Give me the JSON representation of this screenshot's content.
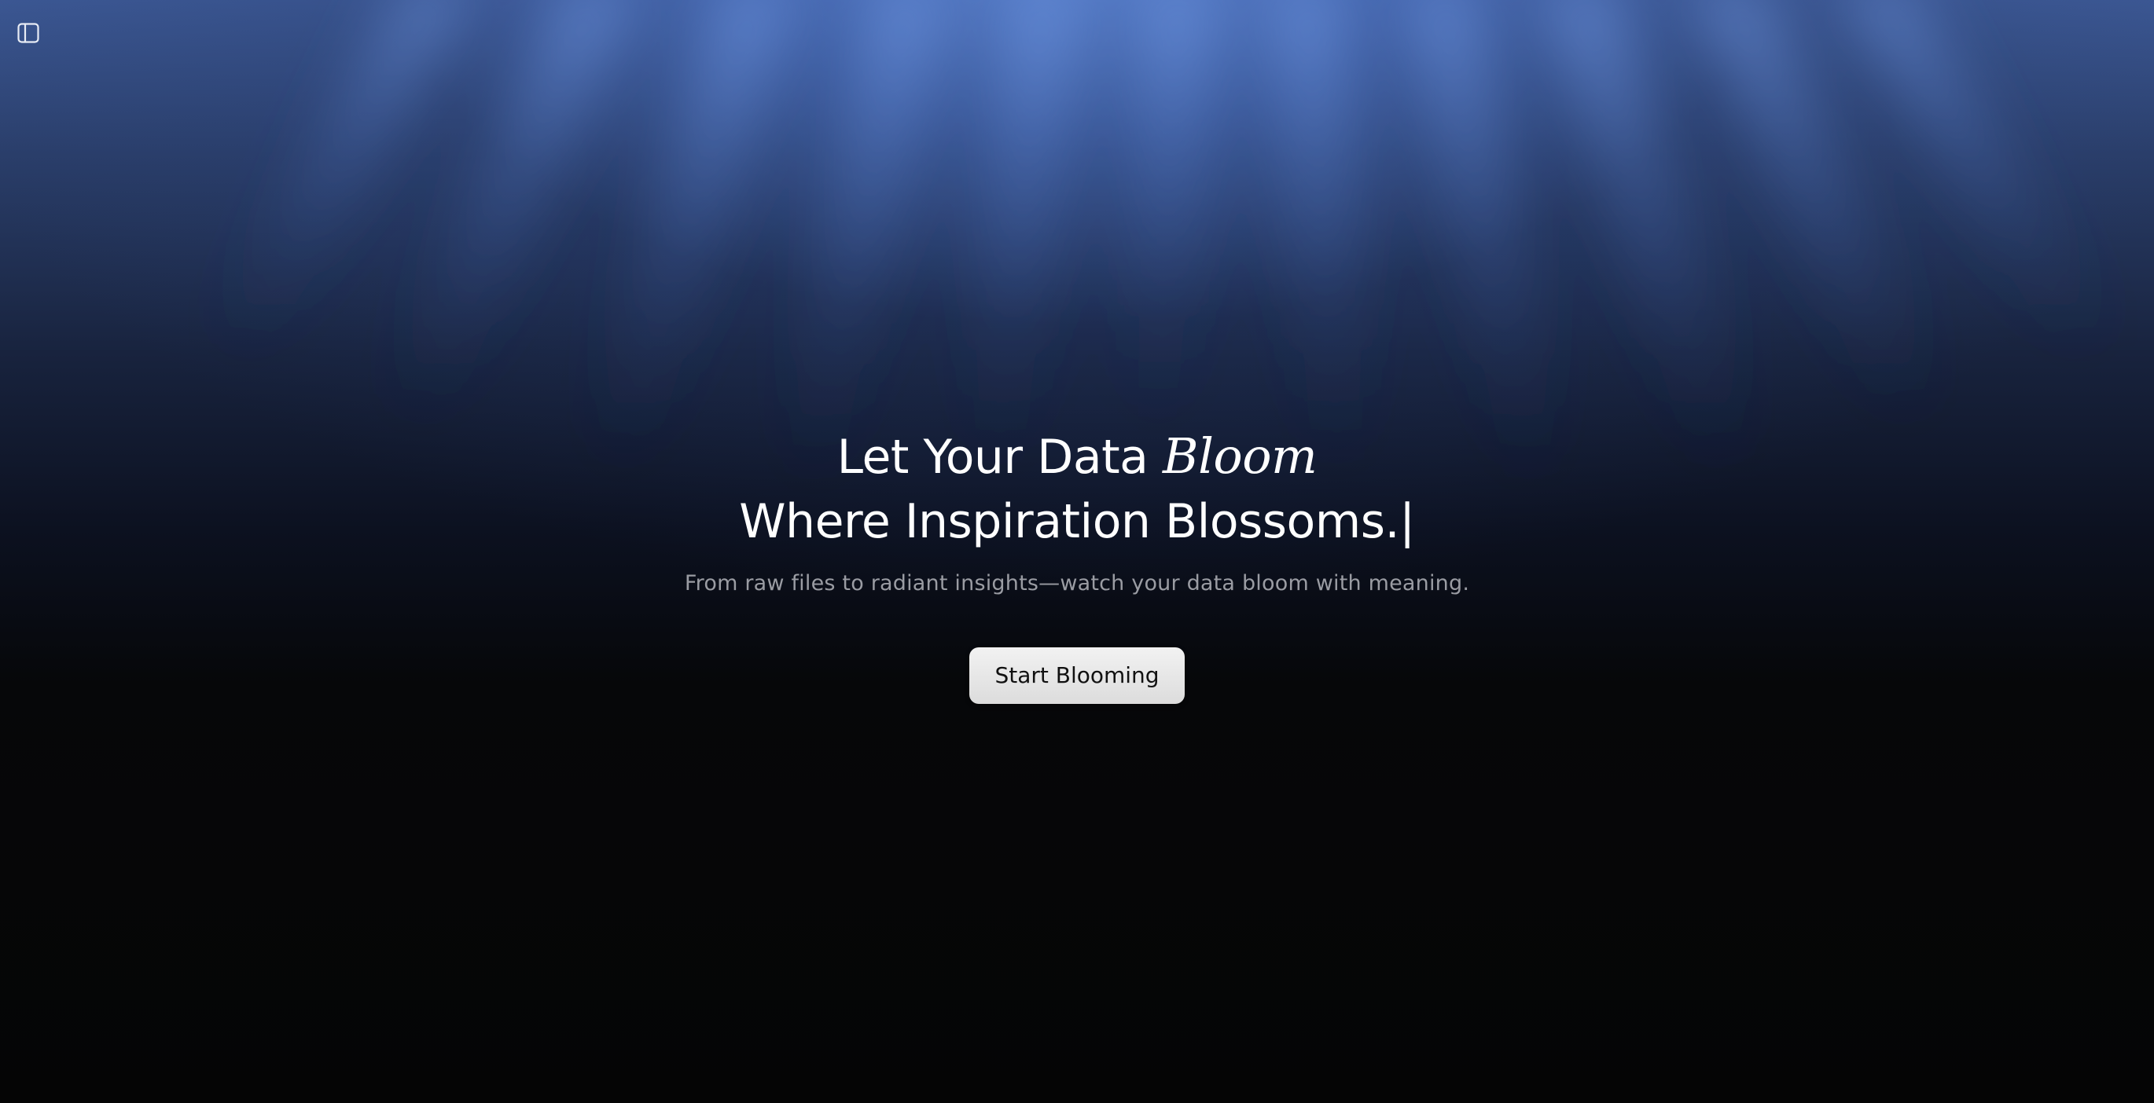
{
  "toolbar": {
    "sidebar_toggle_icon": "sidebar-panel-icon"
  },
  "hero": {
    "headline_line1_prefix": "Let Your Data ",
    "headline_line1_accent": "Bloom",
    "headline_line2": "Where Inspiration Blossoms.|",
    "subtitle": "From raw files to radiant insights—watch your data bloom with meaning.",
    "cta_label": "Start Blooming"
  },
  "colors": {
    "background": "#050505",
    "glow": "#5b86d6",
    "headline": "#ffffff",
    "subtitle": "#9a9ca3",
    "button_bg": "#e6e6e6",
    "button_text": "#111111"
  }
}
